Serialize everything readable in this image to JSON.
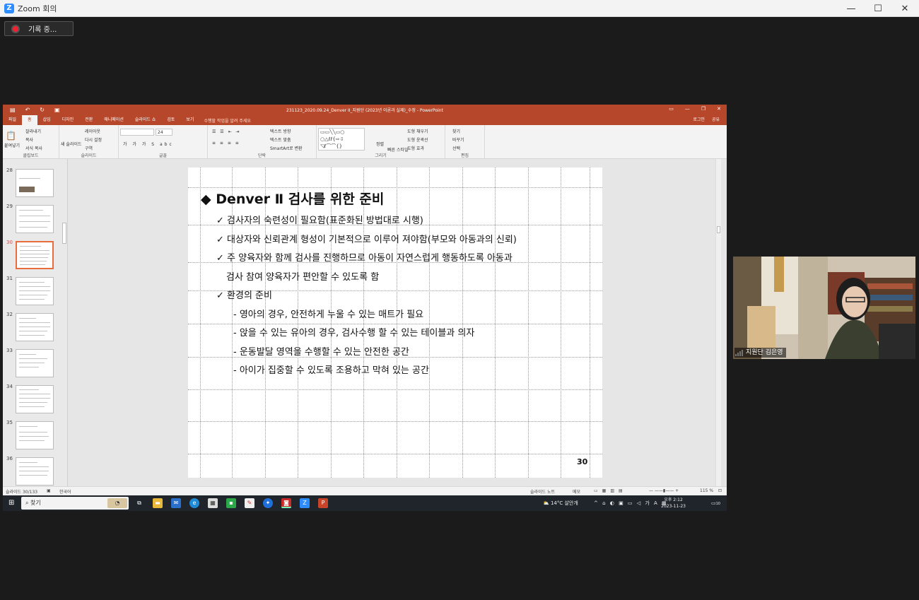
{
  "zoom": {
    "window_title": "Zoom 회의",
    "recording_label": "기록 중..."
  },
  "powerpoint": {
    "document_title": "231123_2020.09.24_Denver II_지원단 (2023년 이론과 실제)_수정 - PowerPoint",
    "tabs": [
      "파일",
      "홈",
      "삽입",
      "디자인",
      "전환",
      "애니메이션",
      "슬라이드 쇼",
      "검토",
      "보기"
    ],
    "tell_me": "수행할 작업을 알려 주세요",
    "login": "로그인",
    "share": "공유",
    "ribbon": {
      "clipboard": {
        "paste": "붙여넣기",
        "cut": "잘라내기",
        "copy": "복사",
        "format_painter": "서식 복사",
        "label": "클립보드"
      },
      "slides": {
        "new_slide": "새 슬라이드",
        "layout": "레이아웃",
        "reset": "다시 설정",
        "section": "구역",
        "label": "슬라이드"
      },
      "font": {
        "font_size": "24",
        "label": "글꼴"
      },
      "paragraph": {
        "text_direction": "텍스트 방향",
        "align_text": "텍스트 맞춤",
        "smartart": "SmartArt로 변환",
        "label": "단락"
      },
      "drawing": {
        "arrange": "정렬",
        "quick_styles": "빠른 스타일",
        "shape_fill": "도형 채우기",
        "shape_outline": "도형 윤곽선",
        "shape_effects": "도형 효과",
        "label": "그리기"
      },
      "editing": {
        "find": "찾기",
        "replace": "바꾸기",
        "select": "선택",
        "label": "편집"
      }
    },
    "thumbnails": [
      "28",
      "29",
      "30",
      "31",
      "32",
      "33",
      "34",
      "35",
      "36"
    ],
    "selected_slide": "30",
    "slide": {
      "title": "◆ Denver Ⅱ 검사를 위한 준비",
      "lines": [
        "✓ 검사자의 숙련성이 필요함(표준화된 방법대로 시행)",
        "✓ 대상자와 신뢰관계 형성이 기본적으로 이루어 져야함(부모와 아동과의 신뢰)",
        "✓ 주 양육자와 함께 검사를 진행하므로 아동이 자연스럽게 행동하도록 아동과",
        "검사 참여 양육자가 편안할 수 있도록 함",
        "✓ 환경의 준비",
        "- 영아의 경우, 안전하게 누울 수 있는 매트가 필요",
        "- 앉을 수 있는 유아의 경우, 검사수행 할 수 있는 테이블과 의자",
        "- 운동발달 영역을 수행할 수 있는 안전한 공간",
        "- 아이가 집중할 수 있도록 조용하고 막혀 있는 공간"
      ],
      "page_number": "30"
    },
    "status": {
      "slide_count": "슬라이드 30/133",
      "language": "한국어",
      "notes": "슬라이드 노트",
      "comments": "메모",
      "zoom": "115 %"
    }
  },
  "taskbar": {
    "search": "찾기",
    "weather": "14°C 살안개",
    "time": "오후 2:12",
    "date": "2023-11-23",
    "notifications": "10"
  },
  "video": {
    "participant_name": "지원단 김은영"
  }
}
